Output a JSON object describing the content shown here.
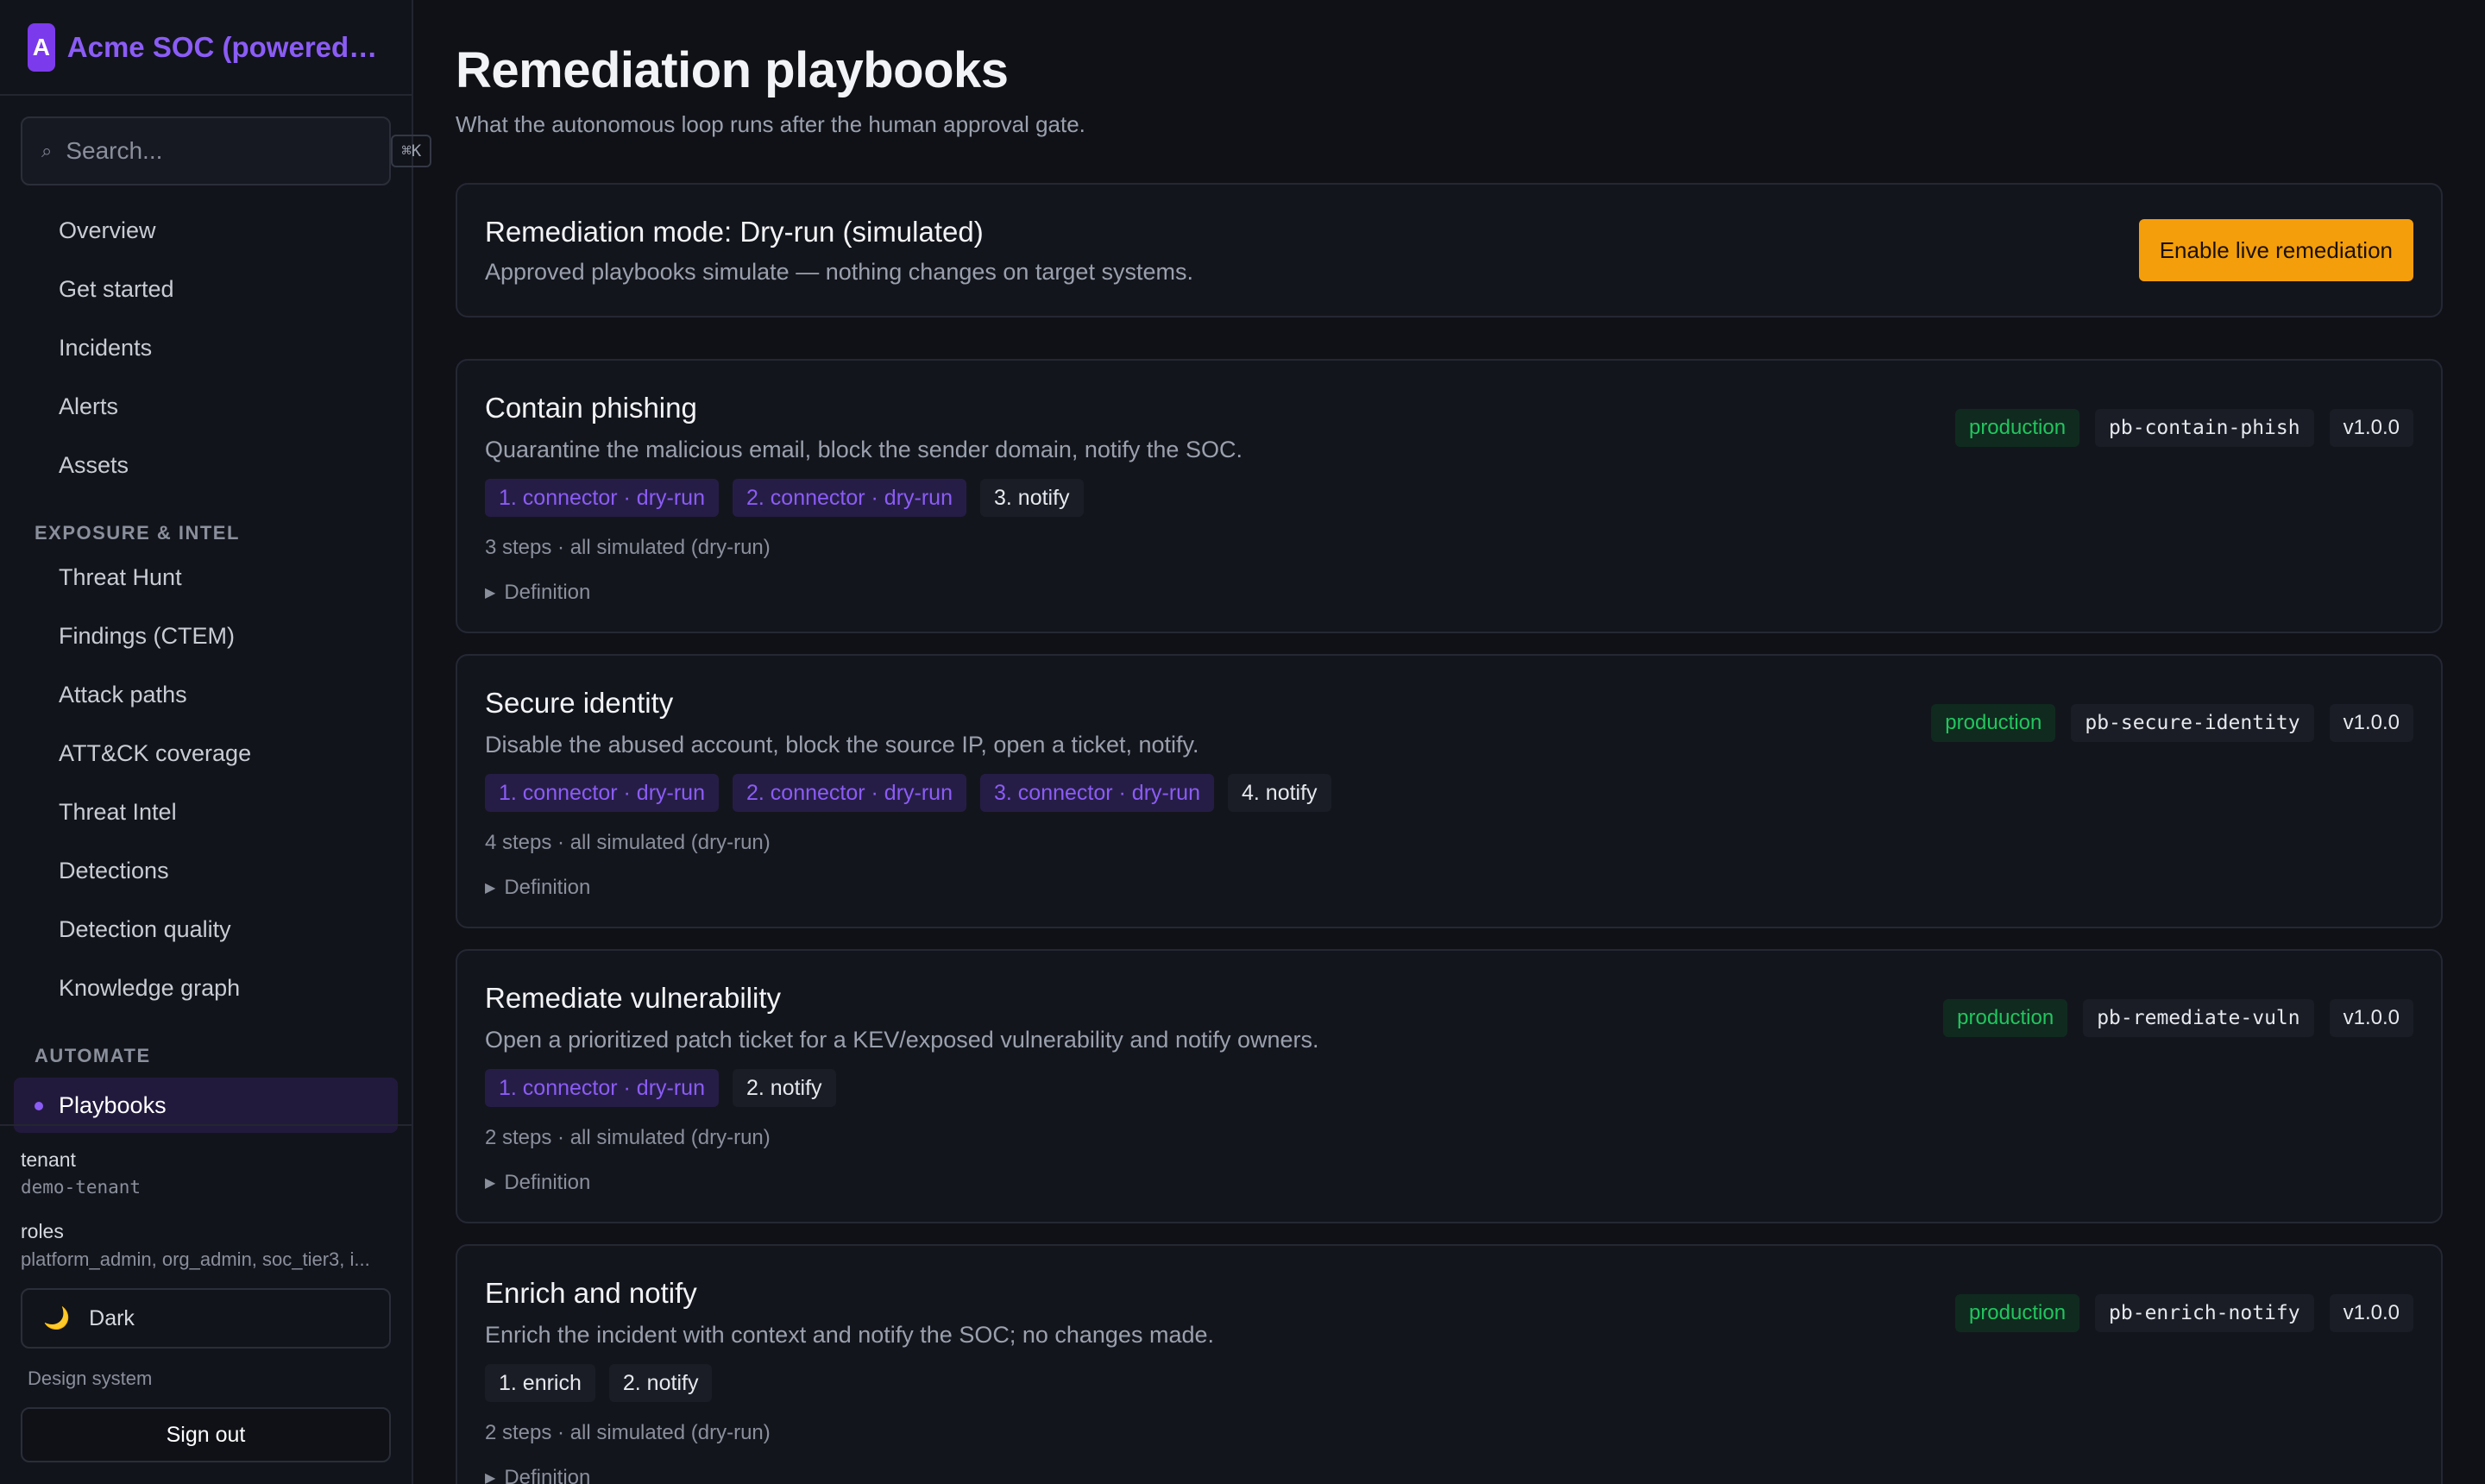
{
  "sidebar": {
    "brand_initial": "A",
    "brand_name": "Acme SOC (powered by …",
    "search_placeholder": "Search...",
    "search_shortcut": "⌘K",
    "nav": [
      "Overview",
      "Get started",
      "Incidents",
      "Alerts",
      "Assets"
    ],
    "section_exposure": "EXPOSURE & INTEL",
    "nav_exposure": [
      "Threat Hunt",
      "Findings (CTEM)",
      "Attack paths",
      "ATT&CK coverage",
      "Threat Intel",
      "Detections",
      "Detection quality",
      "Knowledge graph"
    ],
    "section_automate": "AUTOMATE",
    "active_item": "Playbooks",
    "footer": {
      "tenant_label": "tenant",
      "tenant_value": "demo-tenant",
      "roles_label": "roles",
      "roles_value": "platform_admin, org_admin, soc_tier3, i...",
      "theme_icon": "🌙",
      "theme_label": "Dark",
      "design_link": "Design system",
      "signout": "Sign out"
    }
  },
  "main": {
    "title": "Remediation playbooks",
    "subtitle": "What the autonomous loop runs after the human approval gate.",
    "mode": {
      "title": "Remediation mode: Dry-run (simulated)",
      "desc": "Approved playbooks simulate — nothing changes on target systems.",
      "button": "Enable live remediation"
    },
    "playbooks": [
      {
        "title": "Contain phishing",
        "desc": "Quarantine the malicious email, block the sender domain, notify the SOC.",
        "steps": [
          "1. connector · dry-run",
          "2. connector · dry-run",
          "3. notify"
        ],
        "summary": "3 steps · all simulated (dry-run)",
        "definition": "Definition",
        "status": "production",
        "slug": "pb-contain-phish",
        "version": "v1.0.0"
      },
      {
        "title": "Secure identity",
        "desc": "Disable the abused account, block the source IP, open a ticket, notify.",
        "steps": [
          "1. connector · dry-run",
          "2. connector · dry-run",
          "3. connector · dry-run",
          "4. notify"
        ],
        "summary": "4 steps · all simulated (dry-run)",
        "definition": "Definition",
        "status": "production",
        "slug": "pb-secure-identity",
        "version": "v1.0.0"
      },
      {
        "title": "Remediate vulnerability",
        "desc": "Open a prioritized patch ticket for a KEV/exposed vulnerability and notify owners.",
        "steps": [
          "1. connector · dry-run",
          "2. notify"
        ],
        "summary": "2 steps · all simulated (dry-run)",
        "definition": "Definition",
        "status": "production",
        "slug": "pb-remediate-vuln",
        "version": "v1.0.0"
      },
      {
        "title": "Enrich and notify",
        "desc": "Enrich the incident with context and notify the SOC; no changes made.",
        "steps": [
          "1. enrich",
          "2. notify"
        ],
        "summary": "2 steps · all simulated (dry-run)",
        "definition": "Definition",
        "status": "production",
        "slug": "pb-enrich-notify",
        "version": "v1.0.0"
      }
    ]
  }
}
